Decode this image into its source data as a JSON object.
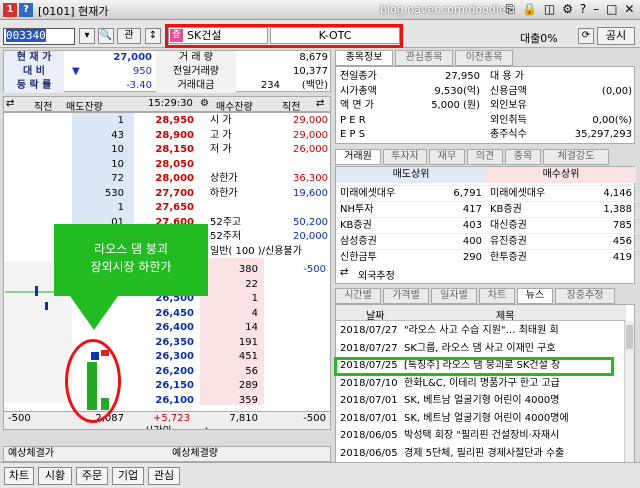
{
  "window": {
    "num": "1",
    "q": "?",
    "title": "[0101] 현재가",
    "blog": "blog.naver.com/doodlee"
  },
  "toolbar": {
    "code": "003340",
    "kwan": "관",
    "name": "SK건설",
    "name_badge": "증",
    "market": "K-OTC",
    "loan": "대출0%",
    "gongsi": "공시"
  },
  "quote": {
    "current_label": "현 재 가",
    "current": "27,000",
    "change_label": "대 비",
    "change_arrow": "▼",
    "change": "950",
    "rate_label": "등 락 률",
    "rate": "-3.40",
    "volume_label": "거 래 량",
    "volume": "8,679",
    "prev_volume_label": "전일거래량",
    "prev_volume": "10,377",
    "amount_label": "거래대금",
    "amount": "234",
    "amount_unit": "(백만)"
  },
  "orderbook": {
    "head": {
      "jikjeon_l": "직전",
      "ask_head": "매도잔량",
      "time": "15:29:30",
      "bid_head": "매수잔량",
      "jikjeon_r": "직전"
    },
    "asks": [
      {
        "qty": "1",
        "price": "28,950"
      },
      {
        "qty": "43",
        "price": "28,900"
      },
      {
        "qty": "10",
        "price": "28,150"
      },
      {
        "qty": "10",
        "price": "28,050"
      },
      {
        "qty": "72",
        "price": "28,000"
      },
      {
        "qty": "530",
        "price": "27,700"
      },
      {
        "qty": "1",
        "price": "27,650"
      },
      {
        "qty": "01",
        "price": "27,600"
      }
    ],
    "side_info": [
      {
        "label": "시 가",
        "value": "29,000"
      },
      {
        "label": "고 가",
        "value": "29,000"
      },
      {
        "label": "저 가",
        "value": "26,000"
      },
      {
        "label": "",
        "value": ""
      },
      {
        "label": "상한가",
        "value": "36,300"
      },
      {
        "label": "하한가",
        "value": "19,600"
      },
      {
        "label": "",
        "value": ""
      },
      {
        "label": "52주고",
        "value": "50,200"
      },
      {
        "label": "52주저",
        "value": "20,000"
      },
      {
        "label": "일반( 100 )/신용불가",
        "value": ""
      }
    ],
    "bids": [
      {
        "price": "",
        "qty": "380",
        "chg": "-500"
      },
      {
        "price": "",
        "qty": "22",
        "chg": ""
      },
      {
        "price": "26,500",
        "qty": "1",
        "chg": ""
      },
      {
        "price": "26,450",
        "qty": "4",
        "chg": ""
      },
      {
        "price": "26,400",
        "qty": "14",
        "chg": ""
      },
      {
        "price": "26,350",
        "qty": "191",
        "chg": ""
      },
      {
        "price": "26,300",
        "qty": "451",
        "chg": ""
      },
      {
        "price": "26,200",
        "qty": "56",
        "chg": ""
      },
      {
        "price": "26,150",
        "qty": "289",
        "chg": ""
      },
      {
        "price": "26,100",
        "qty": "359",
        "chg": ""
      }
    ],
    "footer": {
      "left_chg": "-500",
      "ask_total": "2,087",
      "diff": "+5,723",
      "bid_total": "7,810",
      "right_chg": "-500",
      "after_label": "시간외"
    },
    "annotation": "라오스 댐 붕괴\n장외시장 하한가"
  },
  "tabs_top": [
    "종목정보",
    "관심종목",
    "이전종목"
  ],
  "info": [
    {
      "l": "전일종가",
      "v": "27,950",
      "l2": "대 용 가",
      "v2": ""
    },
    {
      "l": "시가총액",
      "v": "9,530(억)",
      "l2": "신용금액",
      "v2": "(0,00)"
    },
    {
      "l": "액 면 가",
      "v": "5,000 (원)",
      "l2": "외인보유",
      "v2": ""
    },
    {
      "l": "P E R",
      "v": "",
      "l2": "외인취득",
      "v2": "0,00(%)"
    },
    {
      "l": "E P S",
      "v": "",
      "l2": "총주식수",
      "v2": "35,297,293"
    }
  ],
  "tabs_mid": [
    "거래원",
    "투자자",
    "재무",
    "의견",
    "종목",
    "체결강도"
  ],
  "brokers": {
    "sell_head": "매도상위",
    "buy_head": "매수상위",
    "rows": [
      {
        "s": "미래에셋대우",
        "sq": "6,791",
        "b": "미래에셋대우",
        "bq": "4,146"
      },
      {
        "s": "NH투자",
        "sq": "417",
        "b": "KB증권",
        "bq": "1,388"
      },
      {
        "s": "KB증권",
        "sq": "403",
        "b": "대신증권",
        "bq": "785"
      },
      {
        "s": "삼성증권",
        "sq": "400",
        "b": "유진증권",
        "bq": "456"
      },
      {
        "s": "신한금투",
        "sq": "290",
        "b": "한투증권",
        "bq": "419"
      }
    ],
    "foreign": "외국추정"
  },
  "tabs_news": [
    "시간별",
    "가격별",
    "일자별",
    "차트",
    "뉴스",
    "장중추정"
  ],
  "news": {
    "date_head": "날짜",
    "title_head": "제목",
    "rows": [
      {
        "d": "2018/07/27",
        "t": "\"라오스 사고 수습 지원\"… 최태원 회"
      },
      {
        "d": "2018/07/27",
        "t": "SK그룹, 라오스 댐 사고 이재민 구호"
      },
      {
        "d": "2018/07/25",
        "t": "[특징주] 라오스 댐 붕괴로 SK건설 장"
      },
      {
        "d": "2018/07/10",
        "t": "한화L&C, 이테리 명품가구 한고 고급"
      },
      {
        "d": "2018/07/01",
        "t": "SK, 베트남 얼굴기형 어린이 4000명"
      },
      {
        "d": "2018/07/01",
        "t": "SK, 베트남 얼굴기형 어린이 4000명에"
      },
      {
        "d": "2018/06/05",
        "t": "박성택 회장 \"필리핀 건설장비·자재시"
      },
      {
        "d": "2018/06/05",
        "t": "경제 5단체, 필리핀 경제사절단과 수출"
      }
    ]
  },
  "expect": {
    "left": "예상체결가",
    "right": "예상체결량"
  },
  "bottom": [
    "차트",
    "시황",
    "주문",
    "기업",
    "관심"
  ]
}
